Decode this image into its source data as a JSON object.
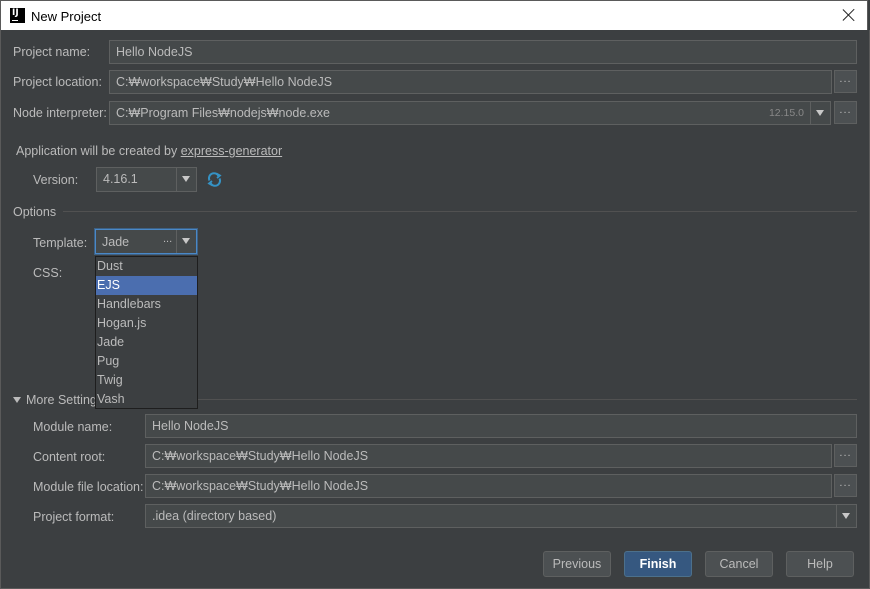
{
  "window": {
    "title": "New Project",
    "app_icon_text": "IJ"
  },
  "project": {
    "name_label": "Project name:",
    "name_value": "Hello NodeJS",
    "location_label": "Project location:",
    "location_value": "C:₩workspace₩Study₩Hello NodeJS",
    "interpreter_label": "Node interpreter:",
    "interpreter_value": "C:₩Program Files₩nodejs₩node.exe",
    "interpreter_version": "12.15.0",
    "browse_label": "..."
  },
  "generator": {
    "info_text": "Application will be created by",
    "link_text": "express-generator",
    "version_label": "Version:",
    "version_value": "4.16.1"
  },
  "options": {
    "header": "Options",
    "template_label": "Template:",
    "template_value": "Jade",
    "template_dots": "...",
    "css_label": "CSS:",
    "dropdown_items": [
      "Dust",
      "EJS",
      "Handlebars",
      "Hogan.js",
      "Jade",
      "Pug",
      "Twig",
      "Vash"
    ],
    "dropdown_selected": "EJS"
  },
  "more_settings": {
    "header": "More Settings",
    "module_name_label": "Module name:",
    "module_name_value": "Hello NodeJS",
    "content_root_label": "Content root:",
    "content_root_value": "C:₩workspace₩Study₩Hello NodeJS",
    "module_file_label": "Module file location:",
    "module_file_value": "C:₩workspace₩Study₩Hello NodeJS",
    "format_label": "Project format:",
    "format_value": ".idea (directory based)"
  },
  "buttons": {
    "previous": "Previous",
    "finish": "Finish",
    "cancel": "Cancel",
    "help": "Help"
  },
  "colors": {
    "background": "#3c3f41",
    "field": "#45494a",
    "selection": "#4b6eaf",
    "primary_button": "#365880"
  }
}
